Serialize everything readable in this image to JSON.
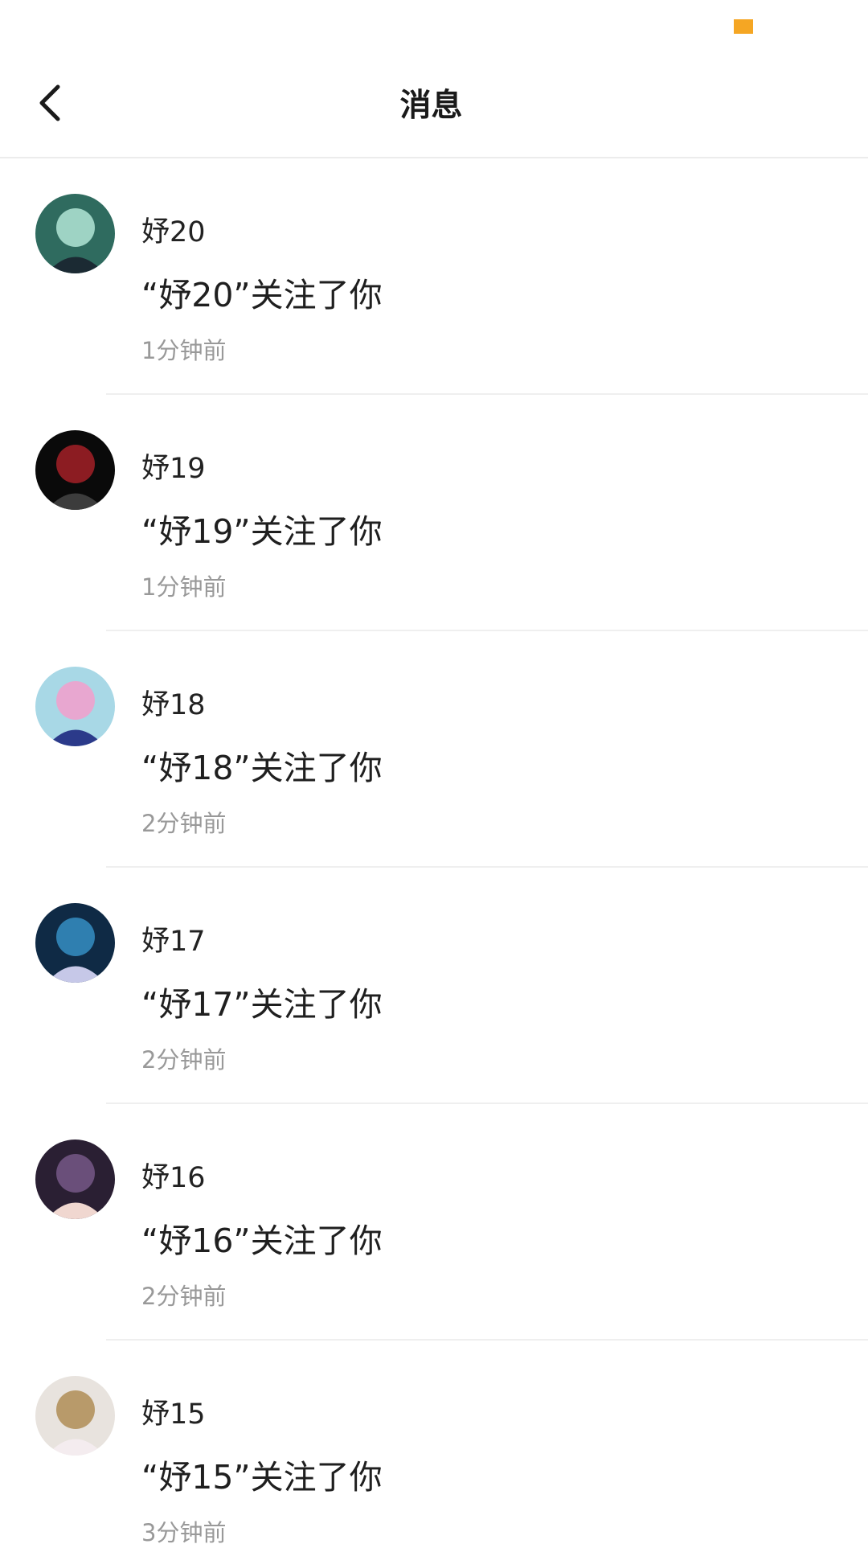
{
  "header": {
    "title": "消息"
  },
  "colors": {
    "status_indicator": "#f5a623",
    "name_text": "#222222",
    "time_text": "#999999",
    "divider": "#efefef"
  },
  "messages": [
    {
      "name": "妤20",
      "text": "“妤20”关注了你",
      "time": "1分钟前",
      "avatar_colors": [
        "#2f6b5f",
        "#9ed3c4",
        "#1b2a33"
      ]
    },
    {
      "name": "妤19",
      "text": "“妤19”关注了你",
      "time": "1分钟前",
      "avatar_colors": [
        "#0a0a0a",
        "#8c1c22",
        "#3c3c3c"
      ]
    },
    {
      "name": "妤18",
      "text": "“妤18”关注了你",
      "time": "2分钟前",
      "avatar_colors": [
        "#a8d8e6",
        "#e8a7d0",
        "#2b3a8a"
      ]
    },
    {
      "name": "妤17",
      "text": "“妤17”关注了你",
      "time": "2分钟前",
      "avatar_colors": [
        "#0f2a45",
        "#2f7fb0",
        "#c6c8e8"
      ]
    },
    {
      "name": "妤16",
      "text": "“妤16”关注了你",
      "time": "2分钟前",
      "avatar_colors": [
        "#2a1f33",
        "#6a4f7a",
        "#f0d7d0"
      ]
    },
    {
      "name": "妤15",
      "text": "“妤15”关注了你",
      "time": "3分钟前",
      "avatar_colors": [
        "#e8e3de",
        "#b89a6a",
        "#f4ecef"
      ]
    }
  ]
}
